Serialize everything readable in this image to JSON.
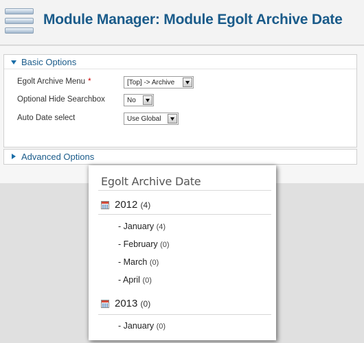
{
  "header": {
    "title": "Module Manager: Module Egolt Archive Date",
    "icon": "module-manager-icon"
  },
  "basic_options": {
    "title": "Basic Options",
    "rows": [
      {
        "label": "Egolt Archive Menu",
        "required_mark": "*",
        "value": "[Top] -> Archive"
      },
      {
        "label": "Optional Hide Searchbox",
        "value": "No"
      },
      {
        "label": "Auto Date select",
        "value": "Use Global"
      }
    ]
  },
  "advanced_options": {
    "title": "Advanced Options"
  },
  "widget": {
    "title": "Egolt Archive Date",
    "years": [
      {
        "year": "2012",
        "count": "(4)",
        "months": [
          {
            "name": "- January",
            "count": "(4)"
          },
          {
            "name": "- February",
            "count": "(0)"
          },
          {
            "name": "- March",
            "count": "(0)"
          },
          {
            "name": "- April",
            "count": "(0)"
          }
        ]
      },
      {
        "year": "2013",
        "count": "(0)",
        "months": [
          {
            "name": "- January",
            "count": "(0)"
          }
        ]
      }
    ]
  },
  "colors": {
    "title_blue": "#1a5b8a",
    "required_red": "#cc0000",
    "page_bg": "#e0e0e0"
  }
}
